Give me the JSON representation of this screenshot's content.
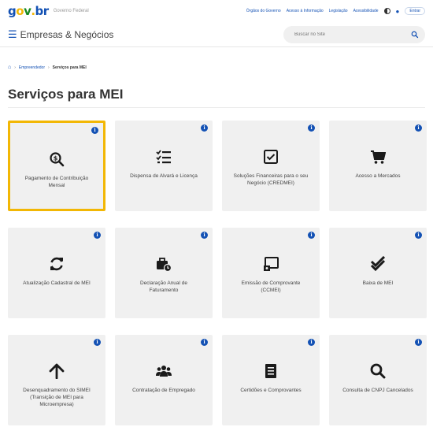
{
  "header": {
    "logo_text": [
      "g",
      "o",
      "v",
      ".",
      "b",
      "r"
    ],
    "gov_sub": "Governo Federal",
    "links": [
      "Órgãos do Governo",
      "Acesso à Informação",
      "Legislação",
      "Acessibilidade"
    ],
    "entrar_label": "Entrar"
  },
  "site": {
    "menu_icon": "hamburger-icon",
    "title": "Empresas & Negócios",
    "search_placeholder": "Buscar no Site"
  },
  "breadcrumb": {
    "items": [
      "Empreendedor",
      "Serviços para MEI"
    ]
  },
  "page": {
    "title": "Serviços para MEI"
  },
  "cards": [
    {
      "label": "Pagamento de Contribuição Mensal",
      "icon": "search-dollar-icon",
      "selected": true
    },
    {
      "label": "Dispensa de Alvará e Licença",
      "icon": "list-check-icon",
      "selected": false
    },
    {
      "label": "Soluções Financeiras para o seu Negócio (CREDMEI)",
      "icon": "checkbox-icon",
      "selected": false
    },
    {
      "label": "Acesso a Mercados",
      "icon": "cart-icon",
      "selected": false
    },
    {
      "label": "Atualização Cadastral de MEI",
      "icon": "sync-icon",
      "selected": false
    },
    {
      "label": "Declaração Anual de Faturamento",
      "icon": "briefcase-clock-icon",
      "selected": false
    },
    {
      "label": "Emissão de Comprovante (CCMEI)",
      "icon": "certificate-icon",
      "selected": false
    },
    {
      "label": "Baixa de MEI",
      "icon": "double-check-icon",
      "selected": false
    },
    {
      "label": "Desenquadramento do SIMEI (Transição de MEI para Microempresa)",
      "icon": "arrow-up-icon",
      "selected": false
    },
    {
      "label": "Contratação de Empregado",
      "icon": "users-icon",
      "selected": false
    },
    {
      "label": "Certidões e Comprovantes",
      "icon": "document-icon",
      "selected": false
    },
    {
      "label": "Consulta de CNPJ Cancelados",
      "icon": "search-icon",
      "selected": false
    }
  ],
  "colors": {
    "primary": "#1351b4",
    "selected_border": "#f2b705",
    "card_bg": "#f0f0f0"
  }
}
